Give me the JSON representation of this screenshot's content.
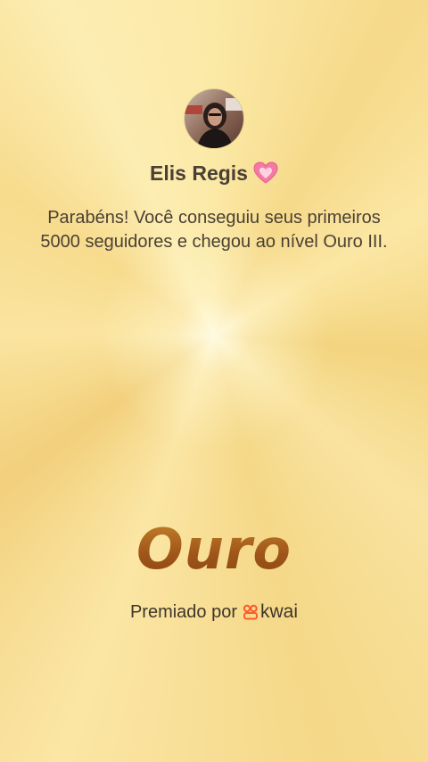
{
  "profile": {
    "name": "Elis Regis",
    "avatar_icon": "user-photo-avatar",
    "heart_icon": "sparkling-heart-icon",
    "heart_color": "#f27aa5"
  },
  "message": "Parabéns! Você conseguiu seus primeiros 5000 seguidores e chegou ao nível Ouro III.",
  "tier": {
    "label": "Ouro",
    "color": "#a35a1c"
  },
  "footer": {
    "awarded_by": "Premiado por",
    "brand": "kwai",
    "brand_color": "#ff5a2c"
  },
  "background_color": "#f8e29e"
}
